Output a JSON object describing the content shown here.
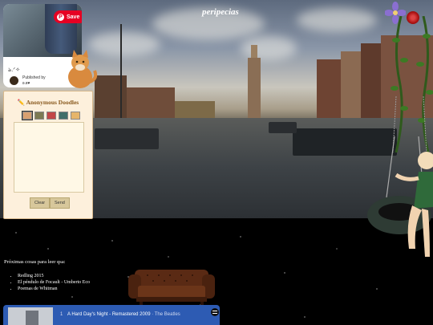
{
  "site": {
    "title": "peripecias"
  },
  "pin": {
    "save_label": "Save",
    "caption": "ঌ.ᐟ✧",
    "published_label": "Published by",
    "publisher_name": "ʚ.ɞ♥"
  },
  "doodles": {
    "title": "✏️ Anonymous Doodles",
    "palette": [
      "#d9a070",
      "#7c7a52",
      "#c24747",
      "#3f6f6a",
      "#e6b56a"
    ],
    "clear_label": "Clear",
    "send_label": "Send"
  },
  "reading": {
    "heading": "Próximas cosas para leer qsa:",
    "items": [
      "Redling 2015",
      "El péndulo de Focault - Umberto Eco",
      "Poemas de Whitman"
    ]
  },
  "player": {
    "track_number": "1",
    "track_title": "A Hard Day's Night - Remastered 2009",
    "separator": " · ",
    "track_artist": "The Beatles"
  },
  "icons": {
    "save": "pinterest-logo-icon",
    "decoration": "purple-flower-icon",
    "rose": "red-rose-button-icon",
    "brand": "spotify-logo-icon"
  }
}
